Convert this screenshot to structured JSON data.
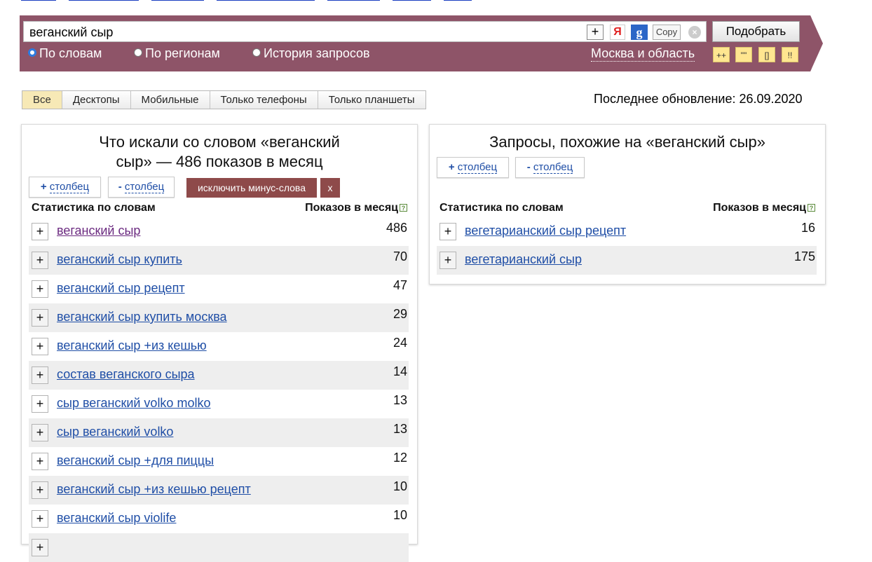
{
  "search": {
    "query": "веганский сыр",
    "copy_label": "Copy",
    "ya_label": "Я",
    "g_label": "g",
    "plus_label": "+",
    "clear_label": "×",
    "submit_label": "Подобрать"
  },
  "modes": [
    {
      "label": "По словам",
      "checked": true
    },
    {
      "label": "По регионам",
      "checked": false
    },
    {
      "label": "История запросов",
      "checked": false
    }
  ],
  "region": "Москва и область",
  "operators": [
    "++",
    "\"\"",
    "[]",
    "!!"
  ],
  "device_tabs": [
    {
      "label": "Все",
      "active": true
    },
    {
      "label": "Десктопы",
      "active": false
    },
    {
      "label": "Мобильные",
      "active": false
    },
    {
      "label": "Только телефоны",
      "active": false
    },
    {
      "label": "Только планшеты",
      "active": false
    }
  ],
  "last_update": "Последнее обновление: 26.09.2020",
  "left_panel": {
    "title_line1": "Что искали со словом «веганский",
    "title_line2": "сыр» — 486 показов в месяц",
    "add_col_sign": "+",
    "add_col_label": "столбец",
    "remove_col_sign": "-",
    "remove_col_label": "столбец",
    "exclude_label": "исключить минус-слова",
    "exclude_close": "x",
    "col_words": "Статистика по словам",
    "col_impressions": "Показов в месяц",
    "help_icon": "?",
    "rows": [
      {
        "phrase": "веганский сыр",
        "count": "486",
        "visited": true
      },
      {
        "phrase": "веганский сыр купить",
        "count": "70"
      },
      {
        "phrase": "веганский сыр рецепт",
        "count": "47"
      },
      {
        "phrase": "веганский сыр купить москва",
        "count": "29"
      },
      {
        "phrase": "веганский сыр +из кешью",
        "count": "24"
      },
      {
        "phrase": "состав веганского сыра",
        "count": "14"
      },
      {
        "phrase": "сыр веганский volko molko",
        "count": "13"
      },
      {
        "phrase": "сыр веганский volko",
        "count": "13"
      },
      {
        "phrase": "веганский сыр +для пиццы",
        "count": "12"
      },
      {
        "phrase": "веганский сыр +из кешью рецепт",
        "count": "10"
      },
      {
        "phrase": "веганский сыр violife",
        "count": "10"
      },
      {
        "phrase": "",
        "count": ""
      }
    ]
  },
  "right_panel": {
    "title": "Запросы, похожие на «веганский сыр»",
    "add_col_sign": "+",
    "add_col_label": "столбец",
    "remove_col_sign": "-",
    "remove_col_label": "столбец",
    "col_words": "Статистика по словам",
    "col_impressions": "Показов в месяц",
    "help_icon": "?",
    "rows": [
      {
        "phrase": "вегетарианский сыр рецепт",
        "count": "16"
      },
      {
        "phrase": "вегетарианский сыр",
        "count": "175"
      }
    ]
  },
  "colors": {
    "banner": "#8e5468",
    "link": "#1f4ea6",
    "visited_link": "#6b2a80",
    "active_tab": "#f7e9b6",
    "exclude_button": "#8e4a4a",
    "operator_bg": "#ffe690"
  }
}
